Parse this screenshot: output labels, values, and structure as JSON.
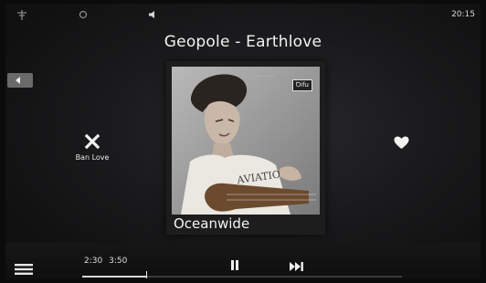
{
  "status": {
    "clock": "20:15",
    "icons": [
      "signal-icon",
      "gps-icon",
      "volume-icon"
    ]
  },
  "now_playing": {
    "title": "Geopole - Earthlove",
    "album": "Oceanwide",
    "art_badge": "Ꝺifu"
  },
  "actions": {
    "ban_label": "Ban Love"
  },
  "player": {
    "elapsed": "2:30",
    "duration": "3:50",
    "progress_fraction": 0.2
  },
  "colors": {
    "background": "#1a1a1c",
    "accent": "#ffffff"
  }
}
